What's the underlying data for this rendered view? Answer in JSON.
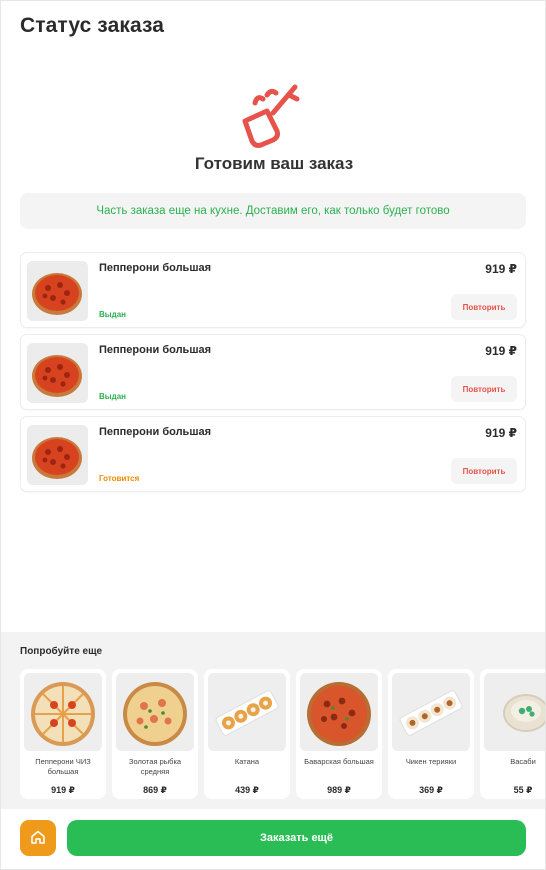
{
  "page": {
    "title": "Статус заказа"
  },
  "status": {
    "heading": "Готовим ваш заказ",
    "notice": "Часть заказа еще на кухне. Доставим его, как только будет готово",
    "icon": "frying-pan-icon",
    "accent_color": "#e5534b"
  },
  "orders": [
    {
      "name": "Пепперони большая",
      "price": "919 ₽",
      "status": "Выдан",
      "status_color": "#2bb14f",
      "repeat_label": "Повторить"
    },
    {
      "name": "Пепперони большая",
      "price": "919 ₽",
      "status": "Выдан",
      "status_color": "#2bb14f",
      "repeat_label": "Повторить"
    },
    {
      "name": "Пепперони большая",
      "price": "919 ₽",
      "status": "Готовится",
      "status_color": "#ef8a00",
      "repeat_label": "Повторить"
    }
  ],
  "recommendations": {
    "title": "Попробуйте еще",
    "items": [
      {
        "name": "Пепперони ЧИЗ большая",
        "price": "919 ₽",
        "kind": "pizza"
      },
      {
        "name": "Золотая рыбка средняя",
        "price": "869 ₽",
        "kind": "pizza"
      },
      {
        "name": "Катана",
        "price": "439 ₽",
        "kind": "sushi"
      },
      {
        "name": "Баварская большая",
        "price": "989 ₽",
        "kind": "pizza"
      },
      {
        "name": "Чикен терияки",
        "price": "369 ₽",
        "kind": "sushi"
      },
      {
        "name": "Васаби",
        "price": "55 ₽",
        "kind": "sauce"
      }
    ]
  },
  "bottom_bar": {
    "home_icon": "home-icon",
    "home_color": "#ef9a1a",
    "order_more_label": "Заказать ещё",
    "order_more_color": "#2bbd55"
  }
}
